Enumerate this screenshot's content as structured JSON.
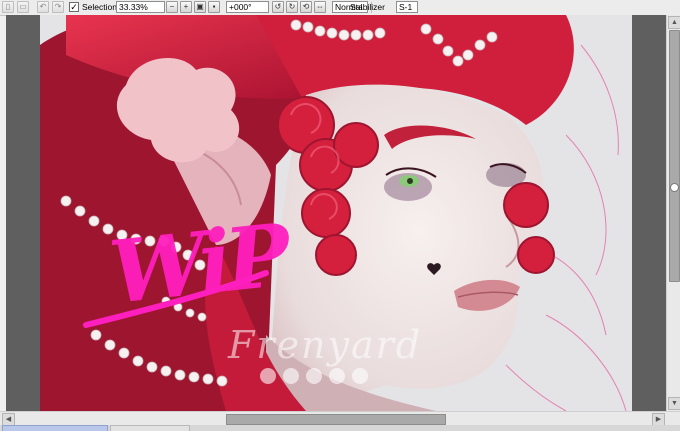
{
  "toolbar": {
    "selection_label": "Selection",
    "selection_checked": "✓",
    "zoom_value": "33.33%",
    "rotation_value": "+000°",
    "blend_mode_value": "Normal",
    "stabilizer_label": "Stabilizer",
    "stabilizer_value": "S-1"
  },
  "canvas": {
    "overlay_text": "WiP",
    "signature_text": "Frenyard"
  },
  "icons": {
    "new": "file-icon",
    "open": "folder-icon",
    "undo": "undo-icon",
    "redo": "redo-icon",
    "zoom_out": "zoom-out-icon",
    "zoom_in": "zoom-in-icon",
    "fit": "fit-view-icon",
    "actual": "actual-size-icon",
    "rot_left": "rotate-left-icon",
    "rot_right": "rotate-right-icon",
    "rot_reset": "rotate-reset-icon",
    "flip": "flip-icon"
  },
  "colors": {
    "hair": "#d31d3c",
    "skin": "#ece4e2",
    "wip": "#ff1fbe",
    "bg": "#e4e4e6"
  }
}
